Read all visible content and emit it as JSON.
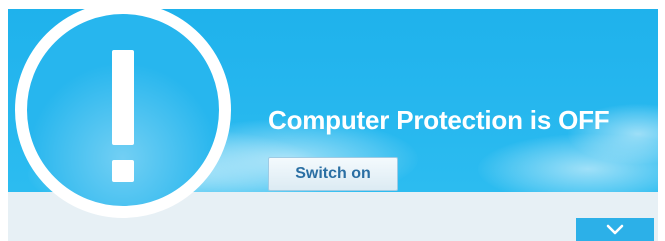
{
  "status": {
    "headline": "Computer Protection is OFF",
    "icon": "exclamation-icon"
  },
  "actions": {
    "switch_on_label": "Switch on",
    "expand_icon": "chevron-down-icon"
  },
  "colors": {
    "banner": "#25b6ee",
    "footer_band": "#e7f0f5",
    "button_text": "#2a6fa3",
    "expand_button": "#2cb0e8"
  }
}
